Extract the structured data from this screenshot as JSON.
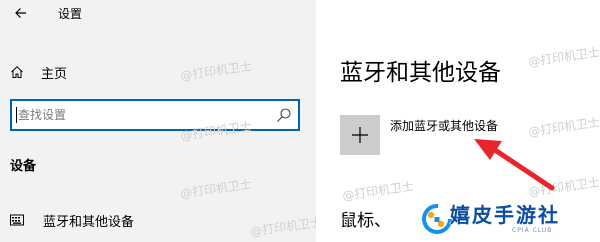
{
  "window": {
    "title": "设置"
  },
  "sidebar": {
    "home_label": "主页",
    "search": {
      "placeholder": "查找设置",
      "value": ""
    },
    "section_header": "设备",
    "items": [
      {
        "label": "蓝牙和其他设备",
        "icon": "keyboard-icon"
      }
    ]
  },
  "main": {
    "title": "蓝牙和其他设备",
    "add_device_label": "添加蓝牙或其他设备",
    "partial_heading": "鼠标、"
  },
  "overlay": {
    "watermark_text": "@打印机卫士",
    "logo_text": "嬉皮手游社",
    "logo_subtext": "CPIA CLUB",
    "arrow_color": "#e8242c",
    "accent_color": "#0063b1"
  }
}
